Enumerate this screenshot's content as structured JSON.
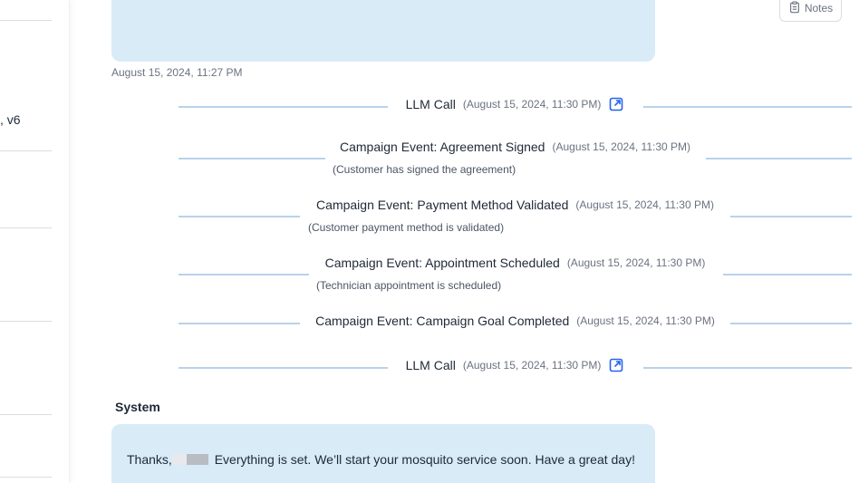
{
  "left_panel": {
    "partial_text": ", v6"
  },
  "notes_button": {
    "label": "Notes",
    "icon": "clipboard-icon"
  },
  "message_top": {
    "timestamp": "August 15, 2024, 11:27 PM"
  },
  "events": [
    {
      "title": "LLM Call",
      "time": "(August 15, 2024, 11:30 PM)",
      "subtitle": "",
      "has_link": true
    },
    {
      "title": "Campaign Event: Agreement Signed",
      "time": "(August 15, 2024, 11:30 PM)",
      "subtitle": "(Customer has signed the agreement)",
      "has_link": false
    },
    {
      "title": "Campaign Event: Payment Method Validated",
      "time": "(August 15, 2024, 11:30 PM)",
      "subtitle": "(Customer payment method is validated)",
      "has_link": false
    },
    {
      "title": "Campaign Event: Appointment Scheduled",
      "time": "(August 15, 2024, 11:30 PM)",
      "subtitle": "(Technician appointment is scheduled)",
      "has_link": false
    },
    {
      "title": "Campaign Event: Campaign Goal Completed",
      "time": "(August 15, 2024, 11:30 PM)",
      "subtitle": "",
      "has_link": false
    },
    {
      "title": "LLM Call",
      "time": "(August 15, 2024, 11:30 PM)",
      "subtitle": "",
      "has_link": true
    }
  ],
  "system_message": {
    "sender": "System",
    "text_before": "Thanks,",
    "text_after": " Everything is set. We’ll start your mosquito service soon. Have a great day!"
  },
  "colors": {
    "bubble": "#d8ebf7",
    "divider_line": "#b9d2ec",
    "link_icon": "#2563eb"
  }
}
